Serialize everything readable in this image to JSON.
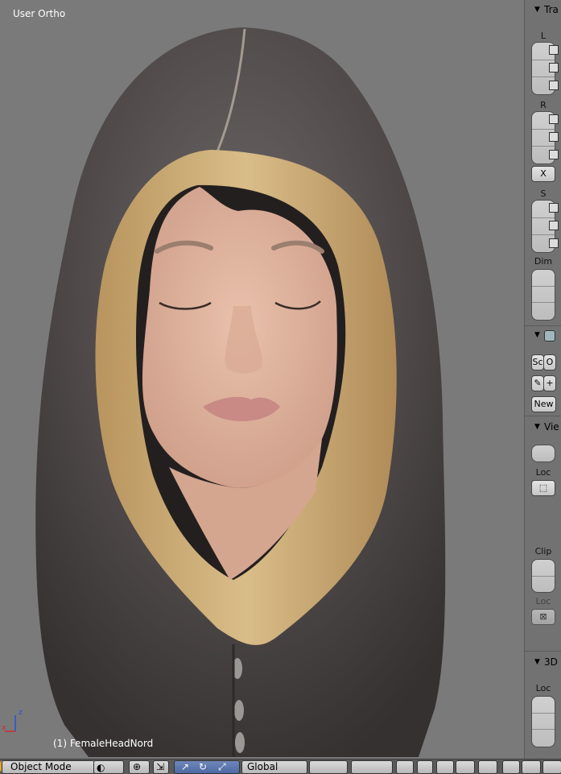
{
  "viewport": {
    "title": "User Ortho",
    "object_label": "(1) FemaleHeadNord",
    "axis": {
      "z": "z",
      "x": "x"
    }
  },
  "npanel": {
    "transform_header": "Tra",
    "location_label": "L",
    "rotation_label": "R",
    "rotation_mode": "X",
    "scale_label": "S",
    "dimensions_label": "Dim",
    "grease_pencil_buttons": {
      "scene": "Sc",
      "object": "O"
    },
    "new_button": "New",
    "view_header": "Vie",
    "lock_label": "Loc",
    "clip_label": "Clip",
    "lock2_label": "Loc",
    "cursor_header": "3D",
    "cursor_location_label": "Loc"
  },
  "header": {
    "mode": "Object Mode",
    "orientation": "Global"
  },
  "colors": {
    "viewport_bg": "#7a7a7a",
    "panel_bg": "#727272",
    "header_bg": "#5a5a5a",
    "axis_x": "#d22a2a",
    "axis_z": "#2a4fd6"
  }
}
